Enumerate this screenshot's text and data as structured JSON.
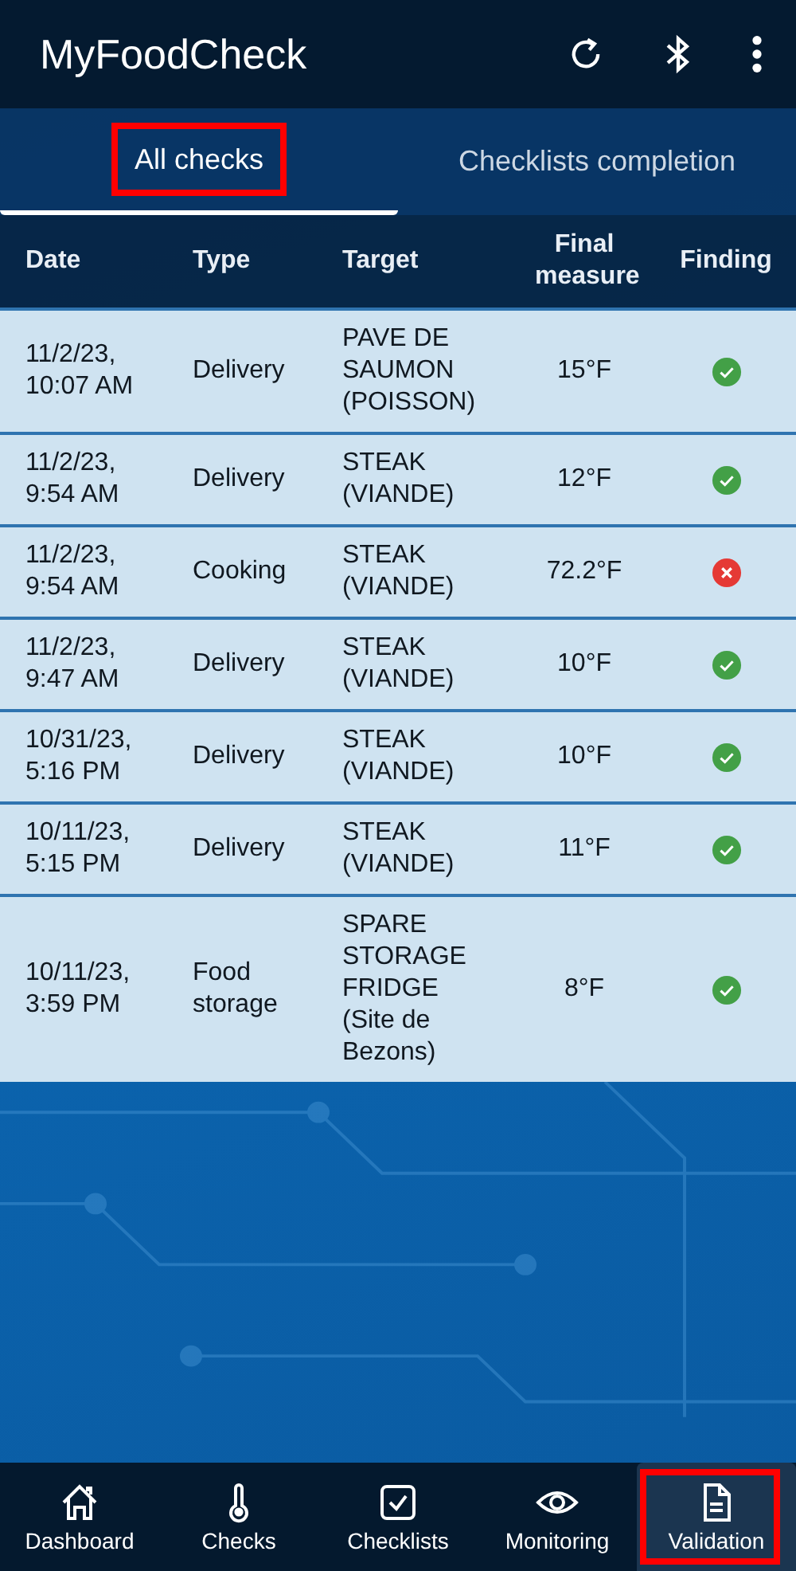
{
  "app": {
    "title": "MyFoodCheck"
  },
  "tabs": [
    {
      "label": "All checks",
      "selected": true,
      "highlighted": true
    },
    {
      "label": "Checklists completion",
      "selected": false,
      "highlighted": false
    }
  ],
  "table": {
    "columns": [
      "Date",
      "Type",
      "Target",
      "Final measure",
      "Finding"
    ],
    "rows": [
      {
        "date": "11/2/23, 10:07 AM",
        "type": "Delivery",
        "target": "PAVE DE SAUMON (POISSON)",
        "final_measure": "15°F",
        "passed": true
      },
      {
        "date": "11/2/23, 9:54 AM",
        "type": "Delivery",
        "target": "STEAK (VIANDE)",
        "final_measure": "12°F",
        "passed": true
      },
      {
        "date": "11/2/23, 9:54 AM",
        "type": "Cooking",
        "target": "STEAK (VIANDE)",
        "final_measure": "72.2°F",
        "passed": false
      },
      {
        "date": "11/2/23, 9:47 AM",
        "type": "Delivery",
        "target": "STEAK (VIANDE)",
        "final_measure": "10°F",
        "passed": true
      },
      {
        "date": "10/31/23, 5:16 PM",
        "type": "Delivery",
        "target": "STEAK (VIANDE)",
        "final_measure": "10°F",
        "passed": true
      },
      {
        "date": "10/11/23, 5:15 PM",
        "type": "Delivery",
        "target": "STEAK (VIANDE)",
        "final_measure": "11°F",
        "passed": true
      },
      {
        "date": "10/11/23, 3:59 PM",
        "type": "Food storage",
        "target": "SPARE STORAGE FRIDGE (Site de Bezons)",
        "final_measure": "8°F",
        "passed": true
      }
    ]
  },
  "nav": [
    {
      "label": "Dashboard",
      "selected": false,
      "highlighted": false
    },
    {
      "label": "Checks",
      "selected": false,
      "highlighted": false
    },
    {
      "label": "Checklists",
      "selected": false,
      "highlighted": false
    },
    {
      "label": "Monitoring",
      "selected": false,
      "highlighted": false
    },
    {
      "label": "Validation",
      "selected": true,
      "highlighted": true
    }
  ]
}
